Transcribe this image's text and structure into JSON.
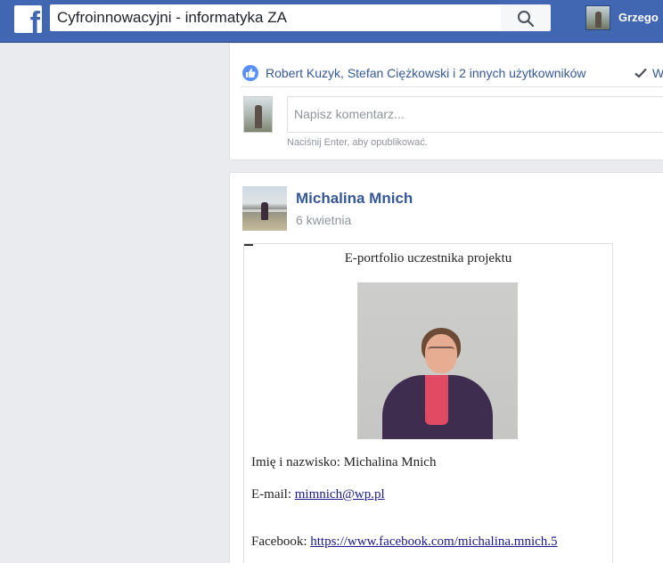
{
  "header": {
    "search_value": "Cyfroinnowacyjni - informatyka ZA",
    "username": "Grzego"
  },
  "post1": {
    "likes_text": "Robert Kuzyk, Stefan Ciężkowski i 2 innych użytkowników",
    "seen_text": "Wys",
    "comment_placeholder": "Napisz komentarz...",
    "comment_hint": "Naciśnij Enter, aby opublikować."
  },
  "post2": {
    "author": "Michalina Mnich",
    "date": "6 kwietnia",
    "document": {
      "title": "E-portfolio uczestnika projektu",
      "name_label": "Imię i nazwisko: ",
      "name_value": "Michalina Mnich",
      "email_label": "E-mail: ",
      "email_value": "mimnich@wp.pl",
      "facebook_label": "Facebook: ",
      "facebook_value": "https://www.facebook.com/michalina.mnich.5"
    }
  },
  "colors": {
    "brand": "#4267b2",
    "link": "#365899",
    "background": "#e9ebee"
  },
  "icons": {
    "logo": "facebook-logo",
    "search": "search-icon",
    "like": "like-icon",
    "check": "check-icon"
  }
}
